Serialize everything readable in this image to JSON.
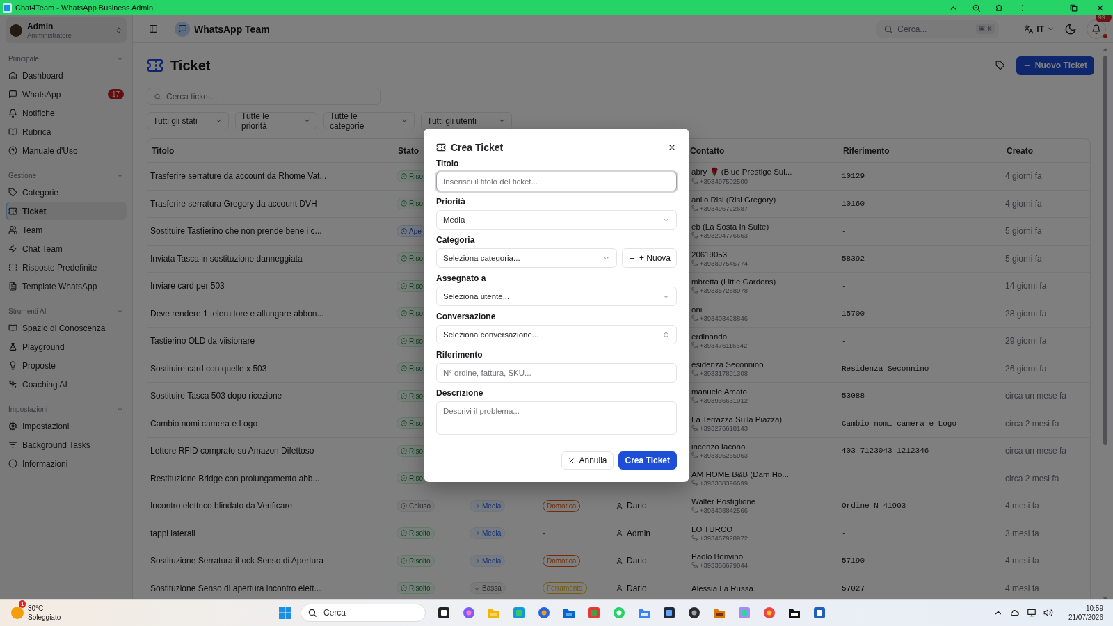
{
  "window": {
    "title": "Chat4Team - WhatsApp Business Admin"
  },
  "sidebar": {
    "user": {
      "name": "Admin",
      "role": "Amministratore"
    },
    "sections": [
      {
        "title": "Principale",
        "expanded": true,
        "items": [
          {
            "label": "Dashboard",
            "selected": false
          },
          {
            "label": "WhatsApp",
            "selected": false,
            "badge": "17"
          },
          {
            "label": "Notifiche",
            "selected": false
          },
          {
            "label": "Rubrica",
            "selected": false
          },
          {
            "label": "Manuale d'Uso",
            "selected": false
          }
        ]
      },
      {
        "title": "Gestione",
        "expanded": true,
        "items": [
          {
            "label": "Categorie",
            "selected": false
          },
          {
            "label": "Ticket",
            "selected": true
          },
          {
            "label": "Team",
            "selected": false
          },
          {
            "label": "Chat Team",
            "selected": false
          },
          {
            "label": "Risposte Predefinite",
            "selected": false
          },
          {
            "label": "Template WhatsApp",
            "selected": false
          }
        ]
      },
      {
        "title": "Strumenti AI",
        "expanded": true,
        "items": [
          {
            "label": "Spazio di Conoscenza",
            "selected": false
          },
          {
            "label": "Playground",
            "selected": false
          },
          {
            "label": "Proposte",
            "selected": false
          },
          {
            "label": "Coaching AI",
            "selected": false
          }
        ]
      },
      {
        "title": "Impostazioni",
        "expanded": true,
        "items": [
          {
            "label": "Impostazioni",
            "selected": false
          },
          {
            "label": "Background Tasks",
            "selected": false
          },
          {
            "label": "Informazioni",
            "selected": false
          }
        ]
      }
    ]
  },
  "topbar": {
    "title": "WhatsApp Team",
    "search_placeholder": "Cerca...",
    "shortcut": "⌘ K",
    "language": "IT",
    "notifications_badge": "99+"
  },
  "page": {
    "title": "Ticket",
    "new_button": "Nuovo Ticket",
    "search_placeholder": "Cerca ticket...",
    "filters": [
      "Tutti gli stati",
      "Tutte le priorità",
      "Tutte le categorie",
      "Tutti gli utenti"
    ]
  },
  "table": {
    "columns": [
      "Titolo",
      "Stato",
      "Contatto",
      "Riferimento",
      "Creato"
    ],
    "rows": [
      {
        "title": "Trasferire serrature da account da Rhome Vat...",
        "status": {
          "text": "Riso",
          "kind": "resolved"
        },
        "contact": {
          "name": "abry 🌹 (Blue Prestige Sui...",
          "phone": "+393497502500"
        },
        "reference": "10129",
        "created": "4 giorni fa"
      },
      {
        "title": "Trasferire serratura Gregory da account DVH",
        "status": {
          "text": "Riso",
          "kind": "resolved"
        },
        "contact": {
          "name": "anilo Risi (Risi Gregory)",
          "phone": "+393496722687"
        },
        "reference": "10160",
        "created": "4 giorni fa"
      },
      {
        "title": "Sostituire Tastierino che non prende bene i c...",
        "status": {
          "text": "Ape",
          "kind": "open"
        },
        "contact": {
          "name": "eb (La Sosta In Suite)",
          "phone": "+393204776663"
        },
        "reference": "-",
        "created": "5 giorni fa"
      },
      {
        "title": "Inviata Tasca in sostituzione danneggiata",
        "status": {
          "text": "Riso",
          "kind": "resolved"
        },
        "contact": {
          "name": "20619053",
          "phone": "+393807545774"
        },
        "reference": "58392",
        "created": "5 giorni fa"
      },
      {
        "title": "Inviare card per 503",
        "status": {
          "text": "Riso",
          "kind": "resolved"
        },
        "contact": {
          "name": "mbretta (Little Gardens)",
          "phone": "+393357288978"
        },
        "reference": "-",
        "created": "14 giorni fa"
      },
      {
        "title": "Deve rendere 1 teleruttore e allungare abbon...",
        "status": {
          "text": "Riso",
          "kind": "resolved"
        },
        "contact": {
          "name": "oni",
          "phone": "+393403428846"
        },
        "reference": "15700",
        "created": "28 giorni fa"
      },
      {
        "title": "Tastierino OLD da viisionare",
        "status": {
          "text": "Riso",
          "kind": "resolved"
        },
        "contact": {
          "name": "erdinando",
          "phone": "+393476116642"
        },
        "reference": "-",
        "created": "29 giorni fa"
      },
      {
        "title": "Sostituire card con quelle x 503",
        "status": {
          "text": "Riso",
          "kind": "resolved"
        },
        "contact": {
          "name": "esidenza Seconnino",
          "phone": "+393317891308"
        },
        "reference": "Residenza Seconnino",
        "created": "26 giorni fa"
      },
      {
        "title": "Sostituire Tasca 503 dopo ricezione",
        "status": {
          "text": "Riso",
          "kind": "resolved"
        },
        "contact": {
          "name": "manuele Amato",
          "phone": "+393936631012"
        },
        "reference": "53088",
        "created": "circa un mese fa"
      },
      {
        "title": "Cambio nomi camera e Logo",
        "status": {
          "text": "Riso",
          "kind": "resolved"
        },
        "contact": {
          "name": "La Terrazza Sulla Piazza)",
          "phone": "+393276618143"
        },
        "reference": "Cambio nomi camera e Logo",
        "created": "circa 2 mesi fa"
      },
      {
        "title": "Lettore RFID comprato su Amazon Difettoso",
        "status": {
          "text": "Riso",
          "kind": "resolved"
        },
        "contact": {
          "name": "incenzo Iacono",
          "phone": "+393395265963"
        },
        "reference": "403-7123043-1212346",
        "created": "circa un mese fa"
      },
      {
        "title": "Restituzione Bridge con prolungamento abb...",
        "status": {
          "text": "Riso",
          "kind": "resolved"
        },
        "contact": {
          "name": "AM HOME B&B (Dam Ho...",
          "phone": "+393338396699"
        },
        "reference": "-",
        "created": "circa 2 mesi fa"
      },
      {
        "title": "Incontro elettrico blindato da Verificare",
        "status": {
          "text": "Chiuso",
          "kind": "closed"
        },
        "priority": {
          "text": "Media",
          "kind": "medium"
        },
        "category": {
          "text": "Domotica",
          "color": "#752c06"
        },
        "assignee": "Dario",
        "contact": {
          "name": "Walter Postiglione",
          "phone": "+393408842566"
        },
        "reference": "Ordine N 41903",
        "created": "4 mesi fa"
      },
      {
        "title": "tappi laterali",
        "status": {
          "text": "Risolto",
          "kind": "resolved"
        },
        "priority": {
          "text": "Media",
          "kind": "medium"
        },
        "category": {
          "text": "-"
        },
        "assignee": "Admin",
        "contact": {
          "name": "LO TURCO",
          "phone": "+393467928972"
        },
        "reference": "-",
        "created": "3 mesi fa"
      },
      {
        "title": "Sostituzione Serratura iLock Senso di Apertura",
        "status": {
          "text": "Risolto",
          "kind": "resolved"
        },
        "priority": {
          "text": "Media",
          "kind": "medium"
        },
        "category": {
          "text": "Domotica",
          "color": "#752c06"
        },
        "assignee": "Dario",
        "contact": {
          "name": "Paolo Bonvino",
          "phone": "+393356679044"
        },
        "reference": "57190",
        "created": "4 mesi fa"
      },
      {
        "title": "Sostituzione Senso di apertura incontro elett...",
        "status": {
          "text": "Risolto",
          "kind": "resolved"
        },
        "priority": {
          "text": "Bassa",
          "kind": "low"
        },
        "category": {
          "text": "Ferramenta",
          "color": "#755a04"
        },
        "assignee": "Dario",
        "contact": {
          "name": "Alessia La Russa"
        },
        "reference": "57027",
        "created": "4 mesi fa"
      }
    ]
  },
  "dialog": {
    "title": "Crea Ticket",
    "fields": [
      {
        "label": "Titolo",
        "kind": "input",
        "placeholder": "Inserisci il titolo del ticket...",
        "focused": true
      },
      {
        "label": "Priorità",
        "kind": "select",
        "value": "Media",
        "focused": false
      },
      {
        "label": "Categoria",
        "kind": "select",
        "placeholder": "Seleziona categoria...",
        "add_button": "+ Nuova",
        "focused": false
      },
      {
        "label": "Assegnato a",
        "kind": "select",
        "placeholder": "Seleziona utente...",
        "focused": false
      },
      {
        "label": "Conversazione",
        "kind": "combobox",
        "placeholder": "Seleziona conversazione...",
        "focused": false
      },
      {
        "label": "Riferimento",
        "kind": "input",
        "placeholder": "N° ordine, fattura, SKU...",
        "focused": false
      },
      {
        "label": "Descrizione",
        "kind": "textarea",
        "placeholder": "Descrivi il problema...",
        "focused": false
      }
    ],
    "buttons": [
      {
        "label": "Annulla",
        "kind": "secondary"
      },
      {
        "label": "Crea Ticket",
        "kind": "primary"
      }
    ]
  },
  "taskbar": {
    "weather": {
      "temperature": "30°C",
      "condition": "Soleggiato",
      "badge": "1"
    },
    "search_placeholder": "Cerca",
    "time": "10:59",
    "date": "21/07/2026"
  }
}
